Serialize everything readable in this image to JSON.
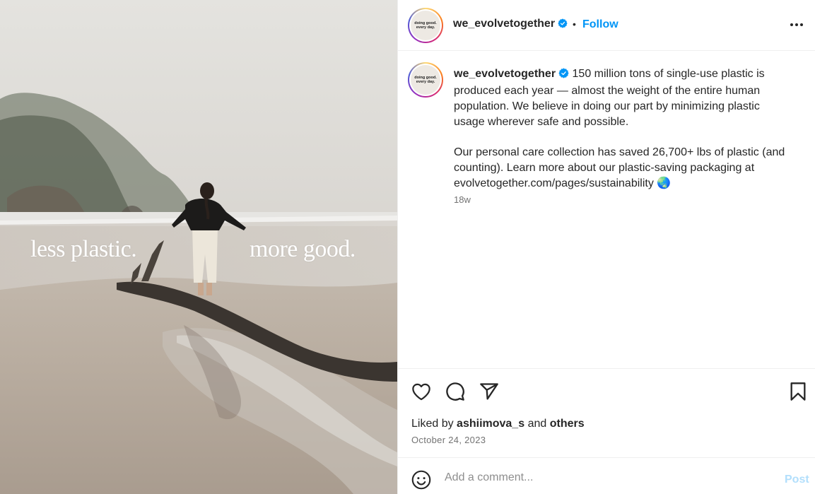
{
  "media": {
    "overlay_left": "less plastic.",
    "overlay_right": "more good."
  },
  "header": {
    "username": "we_evolvetogether",
    "verified": true,
    "separator": "•",
    "follow_label": "Follow",
    "avatar_text_line1": "doing good.",
    "avatar_text_line2": "every day."
  },
  "caption": {
    "username": "we_evolvetogether",
    "paragraph1": "150 million tons of single-use plastic is produced each year — almost the weight of the entire human population. We believe in doing our part by minimizing plastic usage wherever safe and possible.",
    "paragraph2": "Our personal care collection has saved 26,700+ lbs of plastic (and counting). Learn more about our plastic-saving packaging at evolvetogether.com/pages/sustainability 🌏",
    "time_ago": "18w"
  },
  "engagement": {
    "liked_by_prefix": "Liked by",
    "liked_by_user": "ashiimova_s",
    "liked_by_and": "and",
    "liked_by_others": "others",
    "date": "October 24, 2023"
  },
  "comment": {
    "placeholder": "Add a comment...",
    "post_label": "Post"
  },
  "colors": {
    "accent": "#0095f6",
    "post_disabled": "#b2dffc",
    "verified": "#0095f6",
    "muted": "#737373"
  },
  "icons": [
    "more-icon",
    "verified-icon",
    "heart-icon",
    "comment-icon",
    "share-icon",
    "bookmark-icon",
    "emoji-icon"
  ]
}
